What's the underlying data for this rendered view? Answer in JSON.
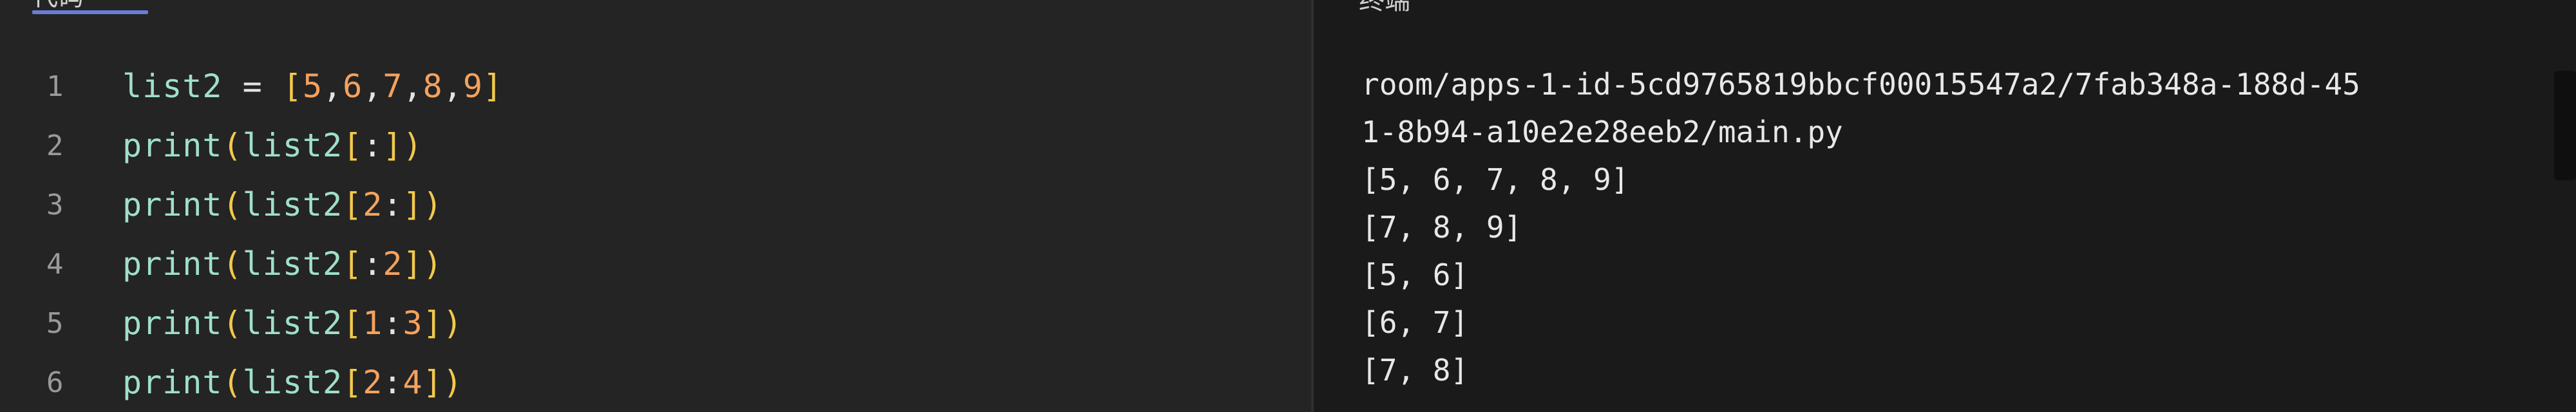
{
  "editor": {
    "tab_label": "代码",
    "lines": [
      {
        "number": "1",
        "tokens": [
          {
            "t": "list2",
            "c": "id"
          },
          {
            "t": " = ",
            "c": "op"
          },
          {
            "t": "[",
            "c": "br"
          },
          {
            "t": "5",
            "c": "num"
          },
          {
            "t": ",",
            "c": "op"
          },
          {
            "t": "6",
            "c": "num"
          },
          {
            "t": ",",
            "c": "op"
          },
          {
            "t": "7",
            "c": "num"
          },
          {
            "t": ",",
            "c": "op"
          },
          {
            "t": "8",
            "c": "num"
          },
          {
            "t": ",",
            "c": "op"
          },
          {
            "t": "9",
            "c": "num"
          },
          {
            "t": "]",
            "c": "br"
          }
        ]
      },
      {
        "number": "2",
        "tokens": [
          {
            "t": "print",
            "c": "fn"
          },
          {
            "t": "(",
            "c": "br"
          },
          {
            "t": "list2",
            "c": "id"
          },
          {
            "t": "[",
            "c": "br"
          },
          {
            "t": ":",
            "c": "op"
          },
          {
            "t": "]",
            "c": "br"
          },
          {
            "t": ")",
            "c": "br"
          }
        ]
      },
      {
        "number": "3",
        "tokens": [
          {
            "t": "print",
            "c": "fn"
          },
          {
            "t": "(",
            "c": "br"
          },
          {
            "t": "list2",
            "c": "id"
          },
          {
            "t": "[",
            "c": "br"
          },
          {
            "t": "2",
            "c": "num"
          },
          {
            "t": ":",
            "c": "op"
          },
          {
            "t": "]",
            "c": "br"
          },
          {
            "t": ")",
            "c": "br"
          }
        ]
      },
      {
        "number": "4",
        "tokens": [
          {
            "t": "print",
            "c": "fn"
          },
          {
            "t": "(",
            "c": "br"
          },
          {
            "t": "list2",
            "c": "id"
          },
          {
            "t": "[",
            "c": "br"
          },
          {
            "t": ":",
            "c": "op"
          },
          {
            "t": "2",
            "c": "num"
          },
          {
            "t": "]",
            "c": "br"
          },
          {
            "t": ")",
            "c": "br"
          }
        ]
      },
      {
        "number": "5",
        "tokens": [
          {
            "t": "print",
            "c": "fn"
          },
          {
            "t": "(",
            "c": "br"
          },
          {
            "t": "list2",
            "c": "id"
          },
          {
            "t": "[",
            "c": "br"
          },
          {
            "t": "1",
            "c": "num"
          },
          {
            "t": ":",
            "c": "op"
          },
          {
            "t": "3",
            "c": "num"
          },
          {
            "t": "]",
            "c": "br"
          },
          {
            "t": ")",
            "c": "br"
          }
        ]
      },
      {
        "number": "6",
        "tokens": [
          {
            "t": "print",
            "c": "fn"
          },
          {
            "t": "(",
            "c": "br"
          },
          {
            "t": "list2",
            "c": "id"
          },
          {
            "t": "[",
            "c": "br"
          },
          {
            "t": "2",
            "c": "num"
          },
          {
            "t": ":",
            "c": "op"
          },
          {
            "t": "4",
            "c": "num"
          },
          {
            "t": "]",
            "c": "br"
          },
          {
            "t": ")",
            "c": "br"
          }
        ]
      }
    ]
  },
  "terminal": {
    "tab_label": "终端",
    "lines": [
      "room/apps-1-id-5cd9765819bbcf00015547a2/7fab348a-188d-45",
      "1-8b94-a10e2e28eeb2/main.py",
      "[5, 6, 7, 8, 9]",
      "[7, 8, 9]",
      "[5, 6]",
      "[6, 7]",
      "[7, 8]"
    ]
  },
  "colors": {
    "identifier": "#9fe0c7",
    "bracket": "#f2c94c",
    "number": "#f5a25d",
    "line_number": "#9a9a9a",
    "terminal_text": "#e8e8e8",
    "tab_accent": "#6a7bd6"
  }
}
